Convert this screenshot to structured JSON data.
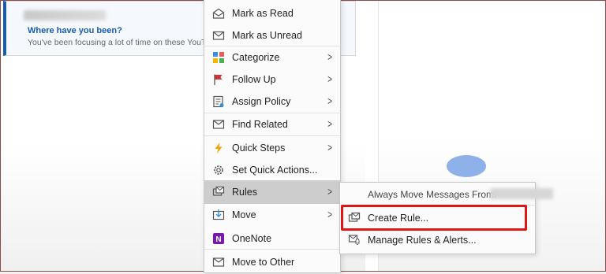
{
  "message": {
    "subject": "Where have you been?",
    "preview": "You've been focusing a lot of time on these YouTub"
  },
  "context_menu": {
    "items": [
      {
        "label": "Mark as Read",
        "icon": "envelope-open-icon"
      },
      {
        "label": "Mark as Unread",
        "icon": "envelope-icon"
      },
      {
        "label": "Categorize",
        "icon": "category-grid-icon",
        "submenu": true
      },
      {
        "label": "Follow Up",
        "icon": "flag-icon",
        "submenu": true
      },
      {
        "label": "Assign Policy",
        "icon": "policy-icon",
        "submenu": true
      },
      {
        "label": "Find Related",
        "icon": "find-related-icon",
        "submenu": true
      },
      {
        "label": "Quick Steps",
        "icon": "lightning-icon",
        "submenu": true
      },
      {
        "label": "Set Quick Actions...",
        "icon": "gear-icon"
      },
      {
        "label": "Rules",
        "icon": "rules-icon",
        "submenu": true
      },
      {
        "label": "Move",
        "icon": "move-icon",
        "submenu": true
      },
      {
        "label": "OneNote",
        "icon": "onenote-icon"
      },
      {
        "label": "Move to Other",
        "icon": "move-to-other-icon"
      }
    ]
  },
  "rules_submenu": {
    "header": "Always Move Messages From:",
    "items": [
      {
        "label": "Create Rule...",
        "icon": "create-rule-icon"
      },
      {
        "label": "Manage Rules & Alerts...",
        "icon": "manage-rules-icon"
      }
    ]
  },
  "colors": {
    "accent_blue": "#1a5da8",
    "highlight_red": "#e01515",
    "flag_red": "#d13438",
    "lightning_orange": "#f2a007",
    "onenote_purple": "#7719aa"
  }
}
